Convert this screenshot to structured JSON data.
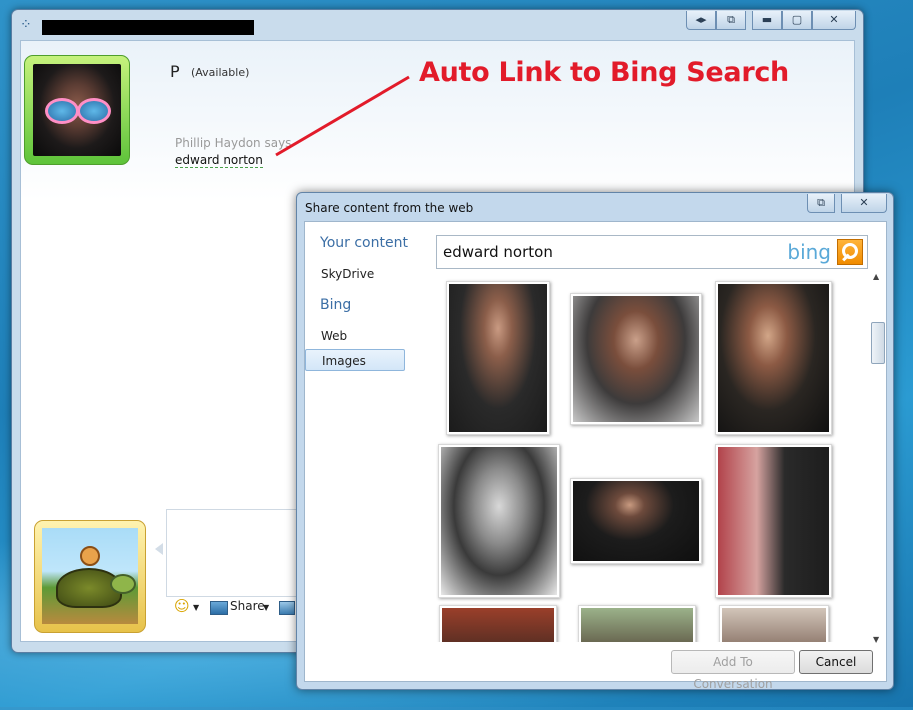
{
  "messenger": {
    "title_redacted": "",
    "contact": {
      "name": "P",
      "status": "(Available)"
    },
    "conversation": {
      "sender_line": "Phillip Haydon says",
      "message": "edward norton"
    },
    "toolbar": {
      "share_label": "Share"
    },
    "window_buttons": {
      "restore_side": "◂▸",
      "popout": "⧉",
      "minimize": "▬",
      "maximize": "▢",
      "close": "✕"
    }
  },
  "annotation": {
    "text": "Auto Link to Bing Search",
    "color": "#e21b2a"
  },
  "share_dialog": {
    "title": "Share content from the web",
    "sidebar": {
      "your_content_heading": "Your content",
      "skydrive": "SkyDrive",
      "bing_heading": "Bing",
      "web": "Web",
      "images": "Images",
      "selected": "Images"
    },
    "search": {
      "value": "edward norton",
      "logo": "bing"
    },
    "buttons": {
      "add": "Add To Conversation",
      "cancel": "Cancel"
    },
    "window_buttons": {
      "popout": "⧉",
      "close": "✕"
    },
    "results_icons": "photo-thumbnail"
  },
  "colors": {
    "accent": "#3b6ea5",
    "bing_orange": "#f08c00",
    "bing_blue": "#5aa9d8"
  }
}
